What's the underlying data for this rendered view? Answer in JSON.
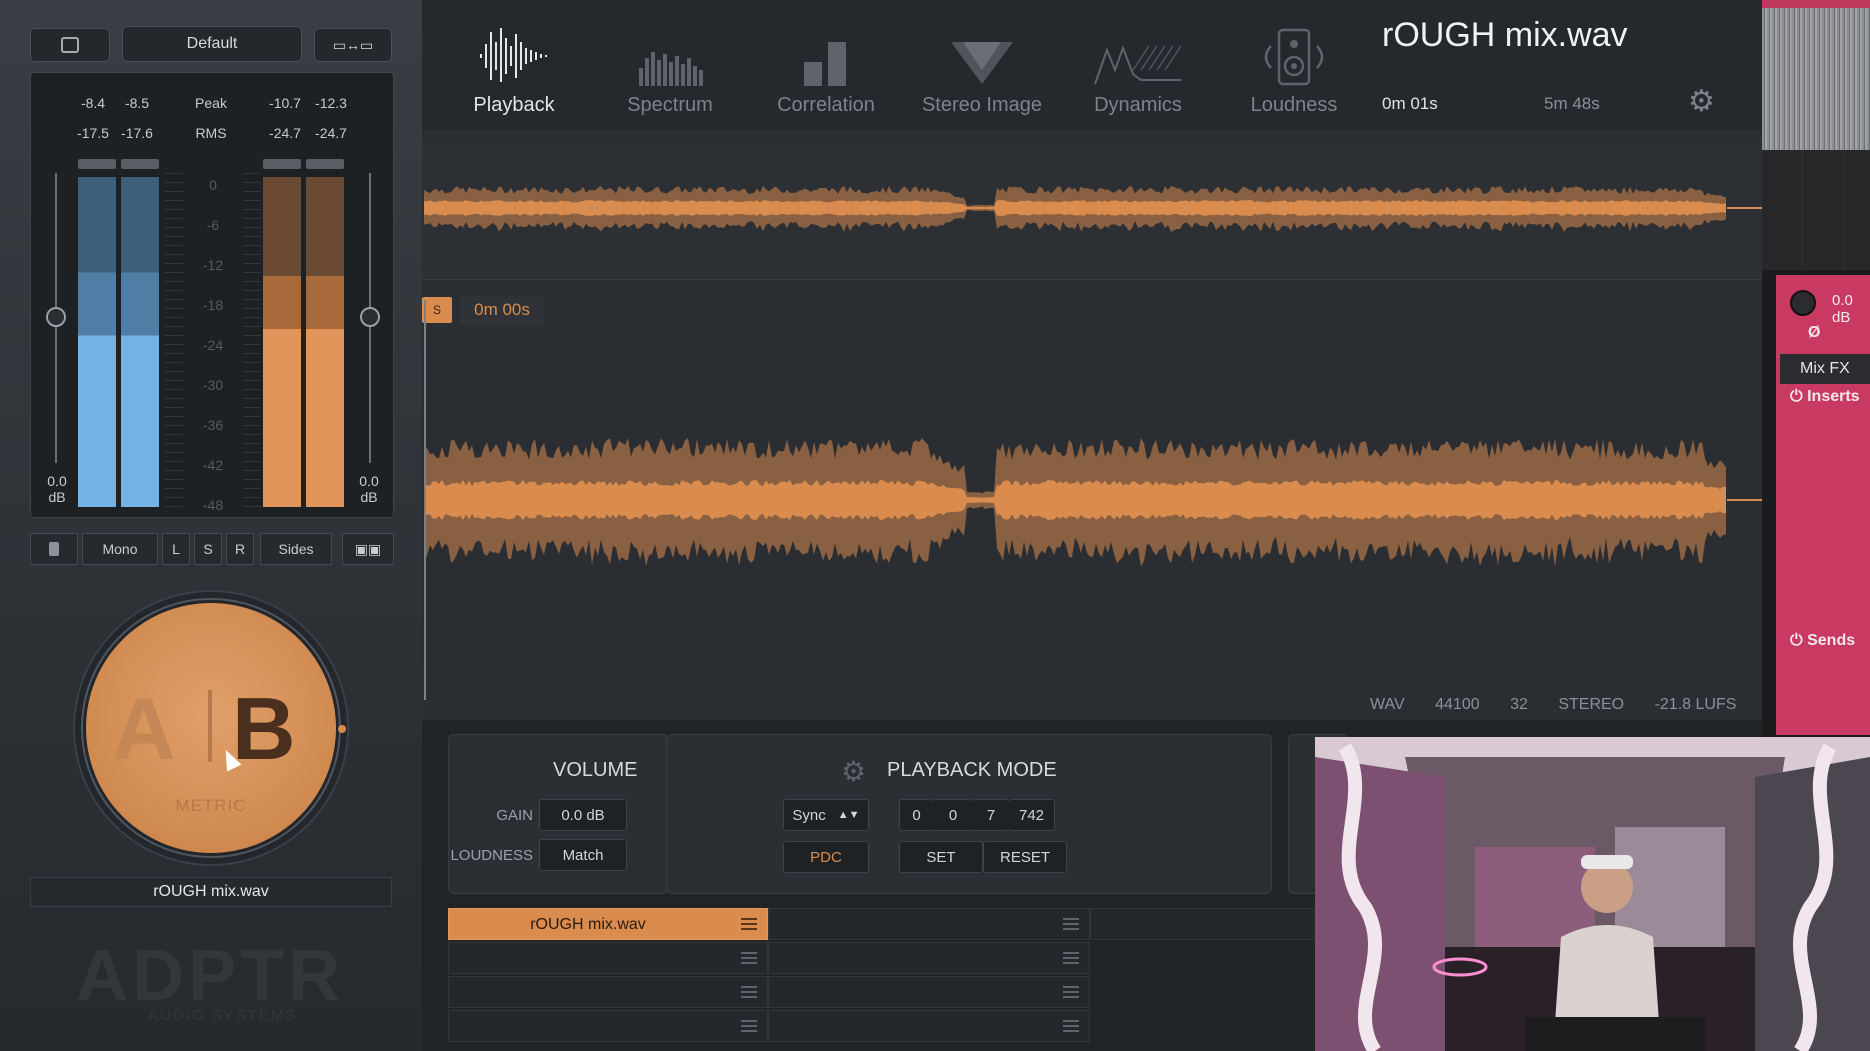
{
  "left_panel": {
    "preset": "Default",
    "readouts": {
      "left_peak": [
        "-8.4",
        "-8.5"
      ],
      "left_rms": [
        "-17.5",
        "-17.6"
      ],
      "peak_label": "Peak",
      "rms_label": "RMS",
      "right_peak": [
        "-10.7",
        "-12.3"
      ],
      "right_rms": [
        "-24.7",
        "-24.7"
      ]
    },
    "scale": [
      "0",
      "-6",
      "-12",
      "-18",
      "-24",
      "-30",
      "-36",
      "-42",
      "-48"
    ],
    "fader_left": {
      "value": "0.0",
      "unit": "dB"
    },
    "fader_right": {
      "value": "0.0",
      "unit": "dB"
    },
    "mode_buttons": [
      "Mono",
      "L",
      "S",
      "R",
      "Sides"
    ],
    "ab": {
      "a": "A",
      "b": "B",
      "label": "METRIC"
    },
    "file_label": "rOUGH mix.wav",
    "logo": "ADPTR",
    "logo_sub": "AUDIO SYSTEMS"
  },
  "tabs": [
    {
      "label": "Playback",
      "icon": "waveform-icon",
      "active": true
    },
    {
      "label": "Spectrum",
      "icon": "spectrum-icon",
      "active": false
    },
    {
      "label": "Correlation",
      "icon": "correlation-icon",
      "active": false
    },
    {
      "label": "Stereo Image",
      "icon": "stereo-image-icon",
      "active": false
    },
    {
      "label": "Dynamics",
      "icon": "dynamics-icon",
      "active": false
    },
    {
      "label": "Loudness",
      "icon": "speaker-icon",
      "active": false
    }
  ],
  "file": {
    "title": "rOUGH mix.wav",
    "position": "0m 01s",
    "length": "5m 48s",
    "marker": "S",
    "marker_time": "0m 00s"
  },
  "info": [
    "WAV",
    "44100",
    "32",
    "STEREO",
    "-21.8 LUFS"
  ],
  "volume": {
    "title": "VOLUME",
    "gain_label": "GAIN",
    "gain_value": "0.0 dB",
    "loudness_label": "LOUDNESS",
    "loudness_button": "Match"
  },
  "playback_mode": {
    "title": "PLAYBACK MODE",
    "sync": "Sync",
    "counters": [
      "0",
      "0",
      "7",
      "742"
    ],
    "pdc": "PDC",
    "set": "SET",
    "reset": "RESET"
  },
  "slots": [
    {
      "label": "rOUGH mix.wav",
      "active": true
    },
    {
      "label": "",
      "active": false
    },
    {
      "label": "",
      "active": false
    },
    {
      "label": "",
      "active": false
    }
  ],
  "right_strip": {
    "db": "0.0 dB",
    "mix_fx": "Mix FX",
    "inserts": "Inserts",
    "sends": "Sends"
  },
  "colors": {
    "accent": "#d98c4e",
    "meter_blue": "#6aaee0",
    "daw_pink": "#c93a63"
  }
}
